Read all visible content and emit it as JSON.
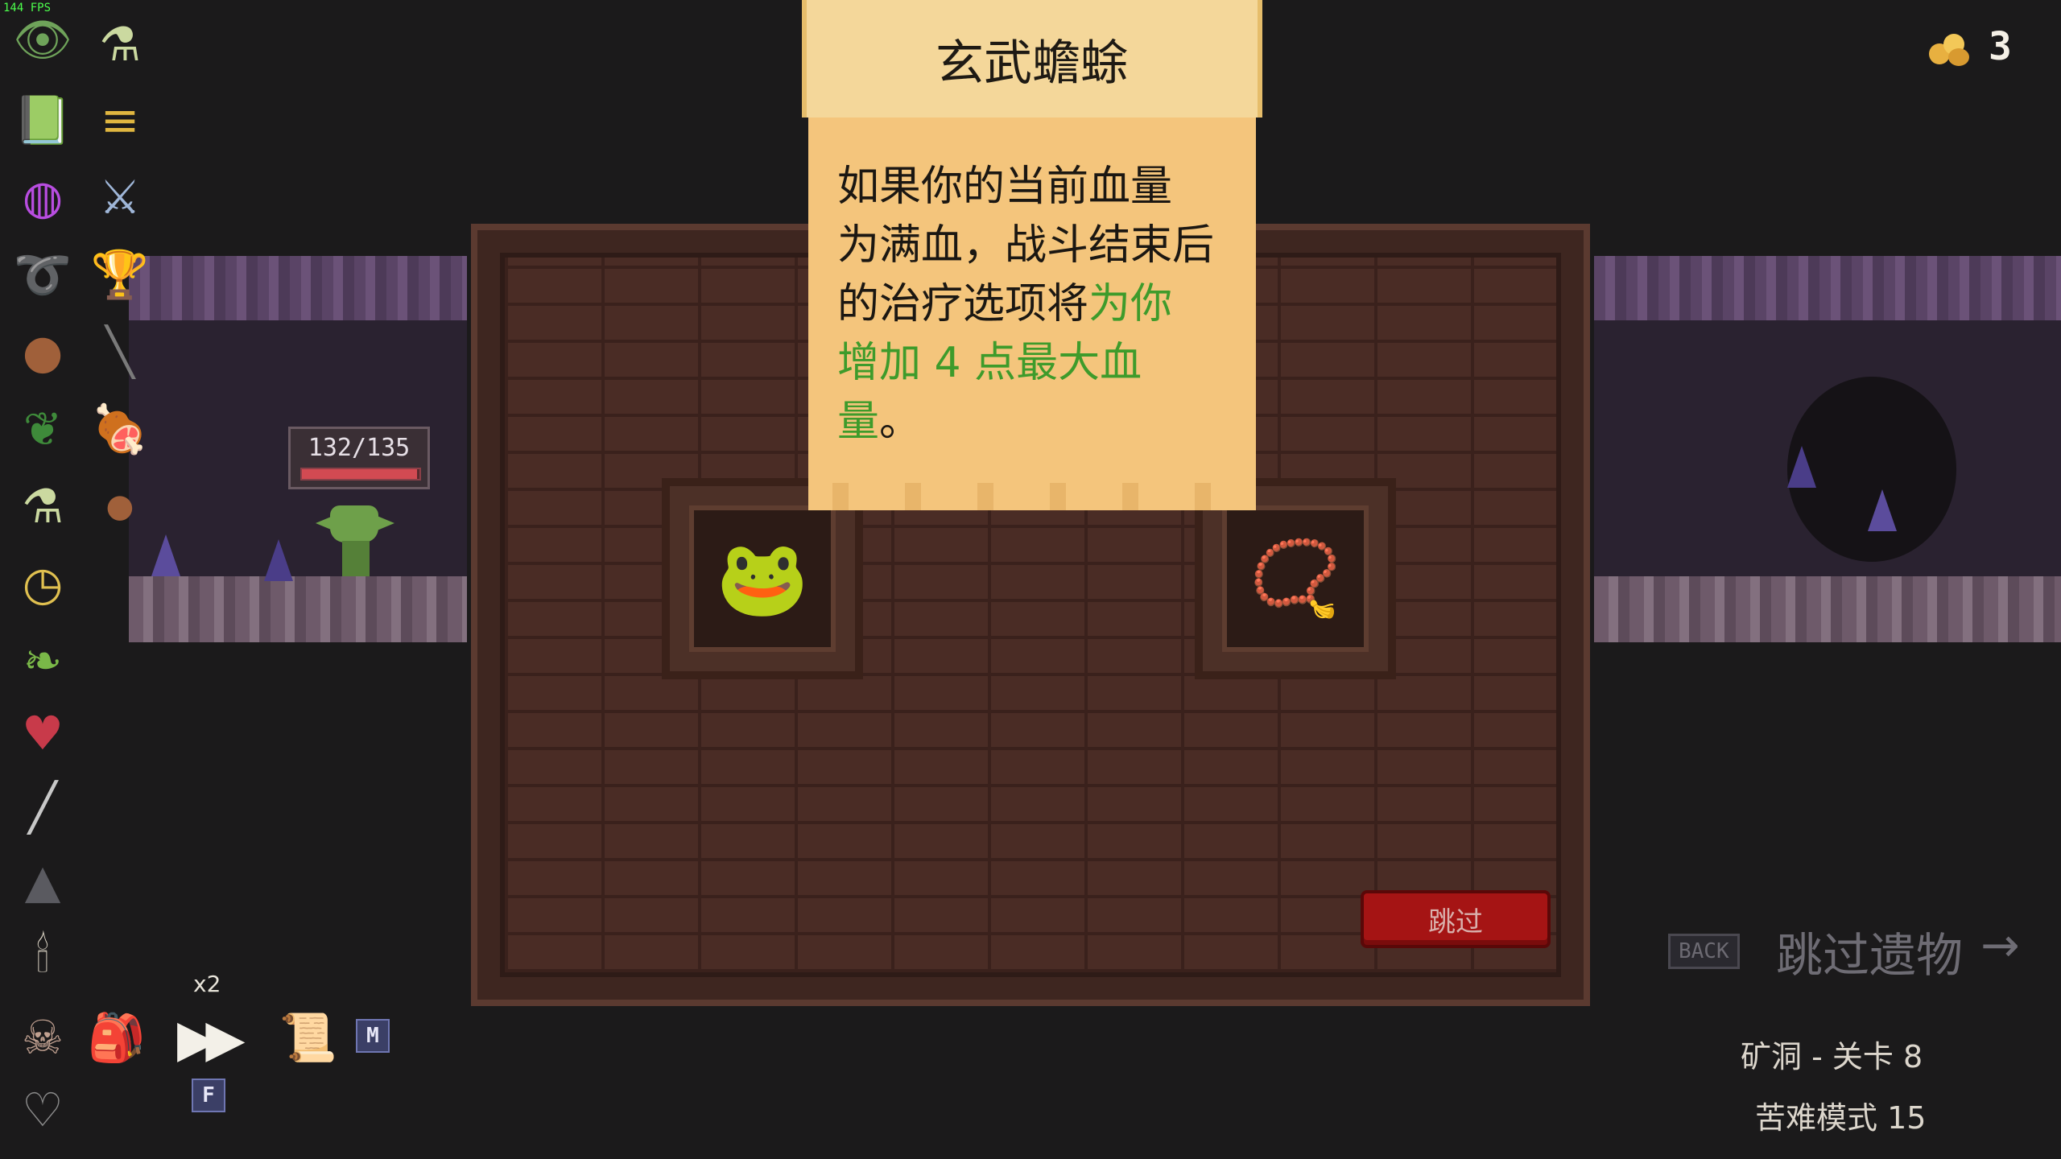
{
  "hud": {
    "fps": "144 FPS",
    "gold_count": "3"
  },
  "player": {
    "hp": "132/135",
    "hp_fraction": 0.978
  },
  "relic_sidebar": {
    "icons": [
      "eye-totem",
      "potion-bottle",
      "spellbook",
      "gold-coins-stack",
      "rainbow-orb",
      "crossed-swords",
      "golden-horn",
      "chalice",
      "cookie",
      "wand",
      "green-leaf",
      "meat-bone",
      "potion-bottle-small",
      "cookie-small",
      "pocket-watch",
      "green-leaf-2",
      "heart-potion",
      "dagger",
      "rock-pile",
      "candle",
      "skull-badge",
      "backpack",
      "map-scroll",
      "empty-heart"
    ]
  },
  "controls": {
    "speed_label": "x2",
    "map_key": "M",
    "fast_key": "F"
  },
  "relic_choice": {
    "tooltip_title": "玄武蟾蜍",
    "tooltip_text_plain": "如果你的当前血量为满血，战斗结束后的治疗选项将",
    "tooltip_text_highlight": "为你增加 4 点最大血量",
    "tooltip_text_end": "。",
    "line1": "如果你的当前血量",
    "line2": "为满血，战斗结束后",
    "line3_plain": "的治疗选项将",
    "line3_hl": "为你",
    "line4_hl": "增加 4 点最大血",
    "line5_hl": "量",
    "line5_plain": "。",
    "skip_button": "跳过",
    "relic_left_icon": "frog-icon",
    "relic_right_icon": "necklace-icon"
  },
  "footer": {
    "back_key": "BACK",
    "skip_relic": "跳过遗物",
    "arrow": "→",
    "level": "矿洞 - 关卡 8",
    "mode": "苦难模式 15"
  },
  "colors": {
    "highlight_green": "#3e9b2b",
    "skip_red": "#a51414",
    "parchment": "#f4c57c"
  }
}
